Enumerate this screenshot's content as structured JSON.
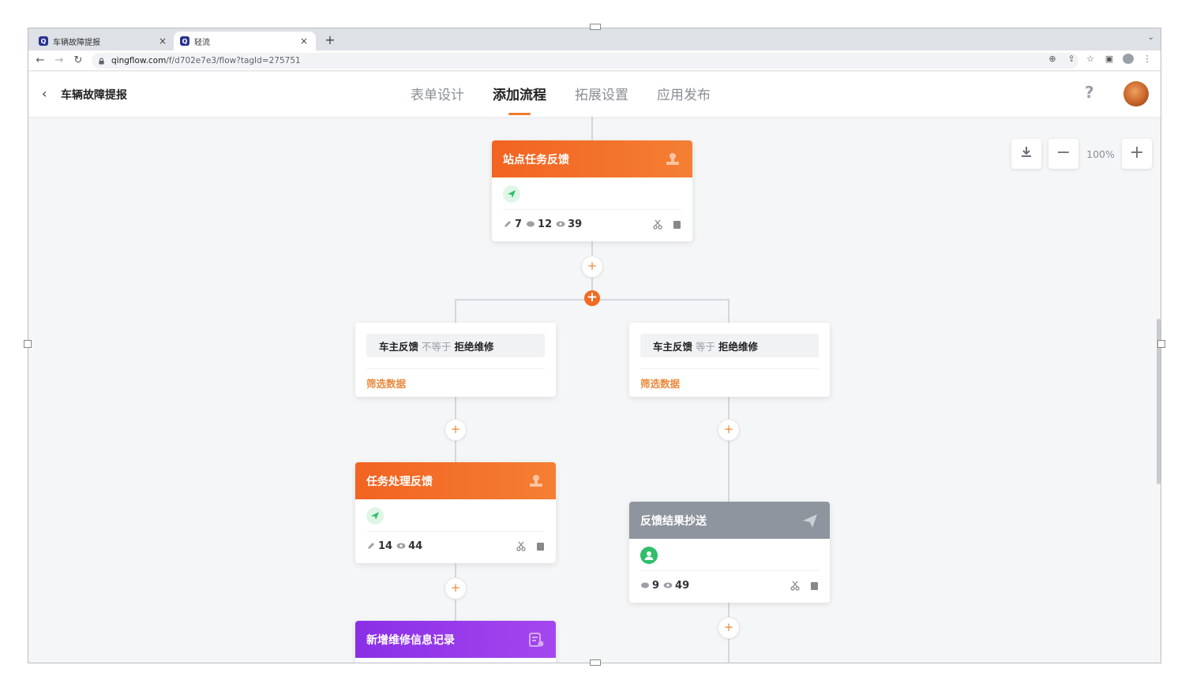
{
  "browser": {
    "tabs": [
      {
        "favicon": "Q",
        "title": "车辆故障提报",
        "active": false
      },
      {
        "favicon": "Q",
        "title": "轻流",
        "active": true
      }
    ],
    "url_host": "qingflow.com",
    "url_path": "/f/d702e7e3/flow?tagId=275751"
  },
  "app": {
    "title": "车辆故障提报",
    "nav_tabs": [
      "表单设计",
      "添加流程",
      "拓展设置",
      "应用发布"
    ],
    "active_tab": "添加流程",
    "help_label": "?"
  },
  "zoom": {
    "level": "100%"
  },
  "nodes": {
    "station_feedback": {
      "title": "站点任务反馈",
      "stats": {
        "edit": "7",
        "comment": "12",
        "view": "39"
      }
    },
    "task_feedback": {
      "title": "任务处理反馈",
      "stats": {
        "edit": "14",
        "view": "44"
      }
    },
    "cc_result": {
      "title": "反馈结果抄送",
      "stats": {
        "comment": "9",
        "view": "49"
      }
    },
    "new_record": {
      "title": "新增维修信息记录"
    }
  },
  "branches": {
    "left": {
      "field": "车主反馈",
      "operator": "不等于",
      "value": "拒绝维修",
      "filter": "筛选数据"
    },
    "right": {
      "field": "车主反馈",
      "operator": "等于",
      "value": "拒绝维修",
      "filter": "筛选数据"
    }
  },
  "colors": {
    "accent": "#f26b21",
    "approval_node": "#f26321",
    "cc_node": "#8e959e",
    "data_node": "#8a2fe6",
    "filter_link": "#e8883a"
  },
  "icons": {
    "approval_node": "stamp-icon",
    "cc_node": "paper-plane-icon",
    "data_node": "form-icon"
  }
}
